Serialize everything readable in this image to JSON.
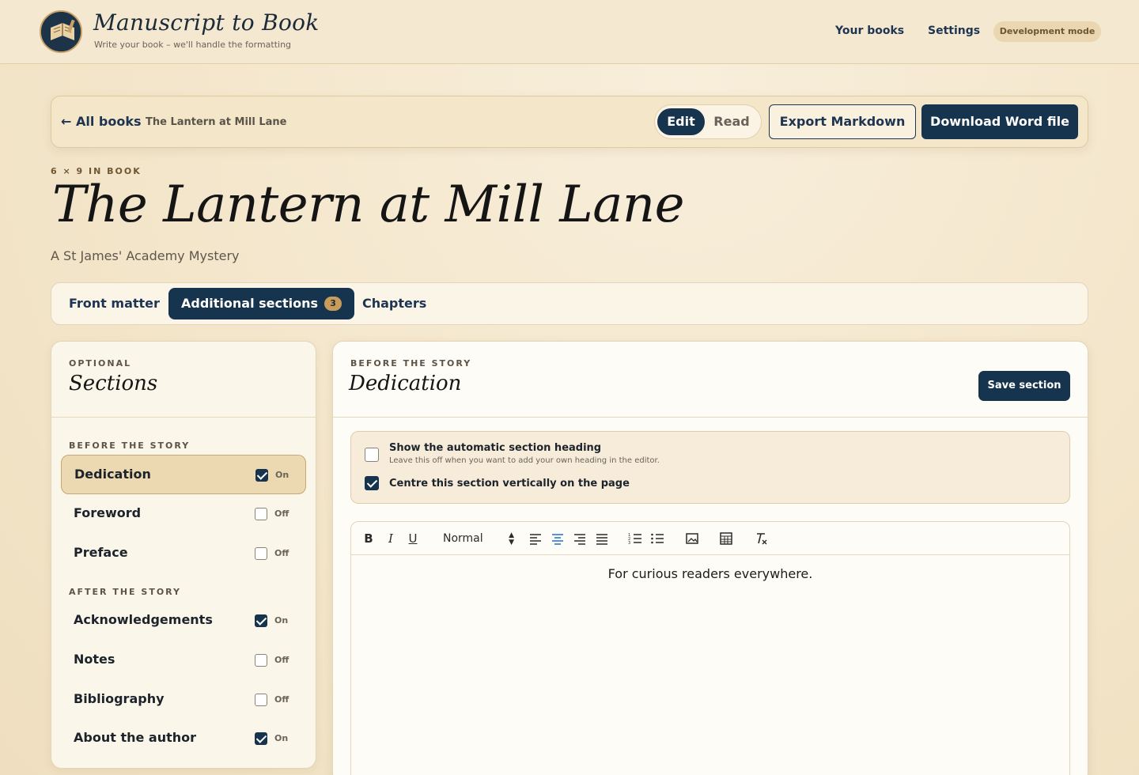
{
  "header": {
    "brand_title": "Manuscript to Book",
    "brand_tagline": "Write your book – we'll handle the formatting",
    "nav": {
      "your_books": "Your books",
      "settings": "Settings"
    },
    "dev_mode_badge": "Development mode"
  },
  "book_bar": {
    "back_label": "← All books",
    "book_title": "The Lantern at Mill Lane",
    "mode": {
      "edit": "Edit",
      "read": "Read",
      "active": "Edit"
    },
    "export_markdown": "Export Markdown",
    "download_word": "Download Word file"
  },
  "book": {
    "trim_size": "6 × 9 IN BOOK",
    "title": "The Lantern at Mill Lane",
    "subtitle": "A St James' Academy Mystery"
  },
  "tabs": {
    "front_matter": "Front matter",
    "additional_sections": "Additional sections",
    "additional_sections_count": "3",
    "chapters": "Chapters",
    "active": "Additional sections"
  },
  "sidebar": {
    "eyebrow": "OPTIONAL",
    "heading": "Sections",
    "group_before": "BEFORE THE STORY",
    "group_after": "AFTER THE STORY",
    "before": [
      {
        "name": "Dedication",
        "state": "On",
        "checked": true,
        "active": true
      },
      {
        "name": "Foreword",
        "state": "Off",
        "checked": false
      },
      {
        "name": "Preface",
        "state": "Off",
        "checked": false
      }
    ],
    "after": [
      {
        "name": "Acknowledgements",
        "state": "On",
        "checked": true
      },
      {
        "name": "Notes",
        "state": "Off",
        "checked": false
      },
      {
        "name": "Bibliography",
        "state": "Off",
        "checked": false
      },
      {
        "name": "About the author",
        "state": "On",
        "checked": true
      }
    ]
  },
  "panel": {
    "eyebrow": "BEFORE THE STORY",
    "heading": "Dedication",
    "save_button": "Save section",
    "options": {
      "show_heading_label": "Show the automatic section heading",
      "show_heading_help": "Leave this off when you want to add your own heading in the editor.",
      "show_heading_checked": false,
      "centre_label": "Centre this section vertically on the page",
      "centre_checked": true
    },
    "editor": {
      "format_select": "Normal",
      "content": "For curious readers everywhere."
    }
  },
  "colors": {
    "navy": "#17344f",
    "accent_gold": "#c89c5b",
    "background": "#f3e6cc"
  }
}
